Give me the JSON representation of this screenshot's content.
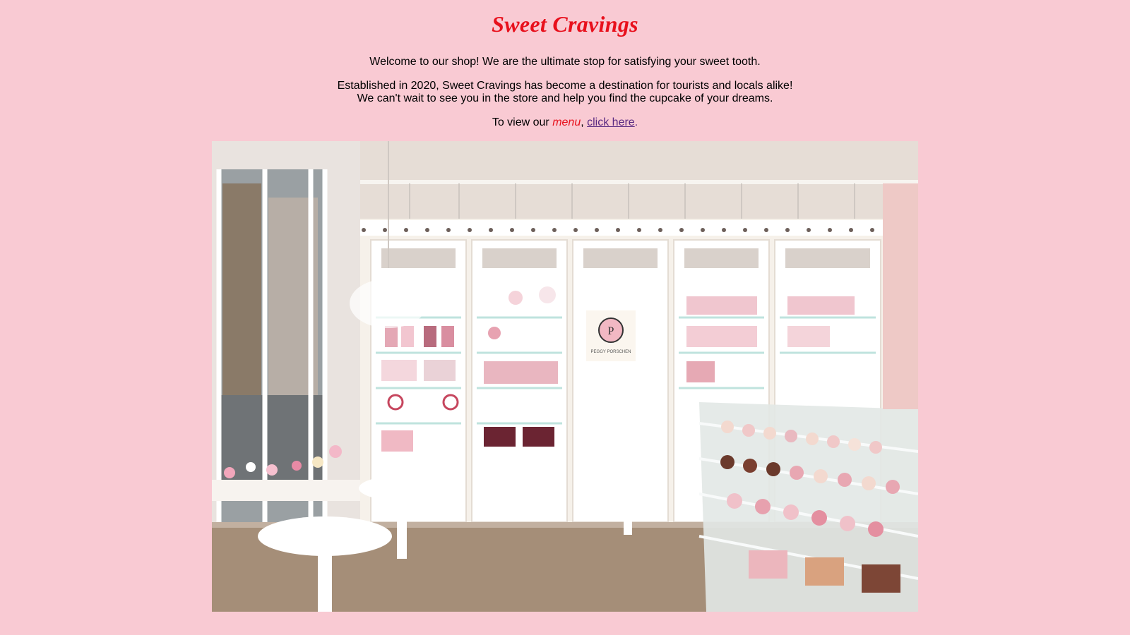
{
  "header": {
    "title": "Sweet Cravings"
  },
  "intro": {
    "welcome": "Welcome to our shop! We are the ultimate stop for satisfying your sweet tooth.",
    "established_line1": "Established in 2020, Sweet Cravings has become a destination for tourists and locals alike!",
    "established_line2": "We can't wait to see you in the store and help you find the cupcake of your dreams.",
    "menu_prefix": "To view our ",
    "menu_word": "menu",
    "menu_comma": ", ",
    "menu_link_label": "click here",
    "menu_period": "."
  },
  "photo": {
    "sign_text": "PEGGY PORSCHEN"
  },
  "colors": {
    "page_background": "#f9cad3",
    "title_color": "#e8101c",
    "link_color": "#5a2a82"
  }
}
